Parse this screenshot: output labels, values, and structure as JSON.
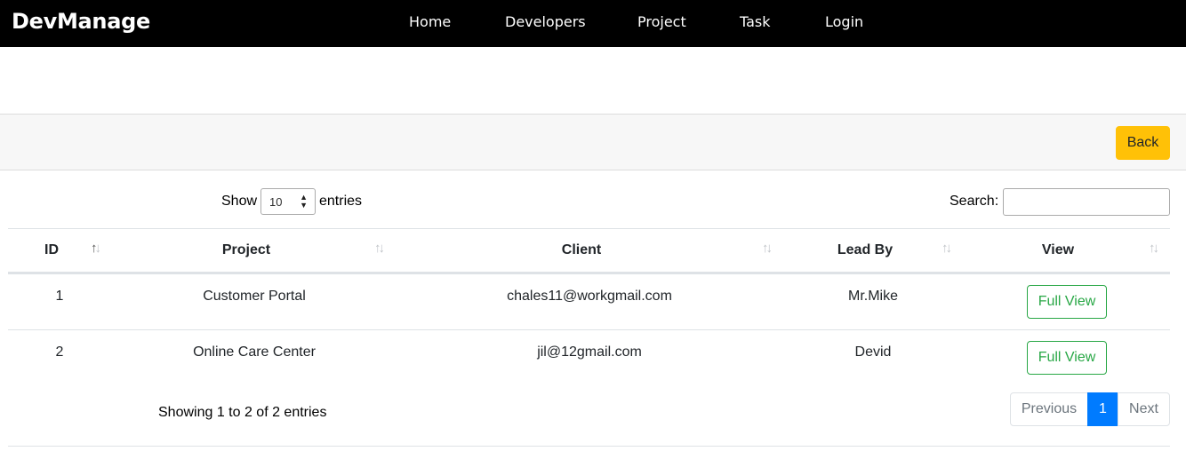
{
  "brand": "DevManage",
  "nav": [
    "Home",
    "Developers",
    "Project",
    "Task",
    "Login"
  ],
  "toolbar": {
    "back_label": "Back"
  },
  "length_menu": {
    "show": "Show",
    "value": "10",
    "entries": "entries"
  },
  "search": {
    "label": "Search:",
    "value": ""
  },
  "table": {
    "headers": [
      "ID",
      "Project",
      "Client",
      "Lead By",
      "View"
    ],
    "rows": [
      {
        "id": "1",
        "project": "Customer Portal",
        "client": "chales11@workgmail.com",
        "lead": "Mr.Mike",
        "action": "Full View"
      },
      {
        "id": "2",
        "project": "Online Care Center",
        "client": "jil@12gmail.com",
        "lead": "Devid",
        "action": "Full View"
      }
    ]
  },
  "footer": {
    "info": "Showing 1 to 2 of 2 entries",
    "previous": "Previous",
    "page": "1",
    "next": "Next"
  },
  "colors": {
    "navbar": "#000000",
    "back_button": "#ffc107",
    "view_button": "#28a745",
    "active_page": "#007bff"
  }
}
